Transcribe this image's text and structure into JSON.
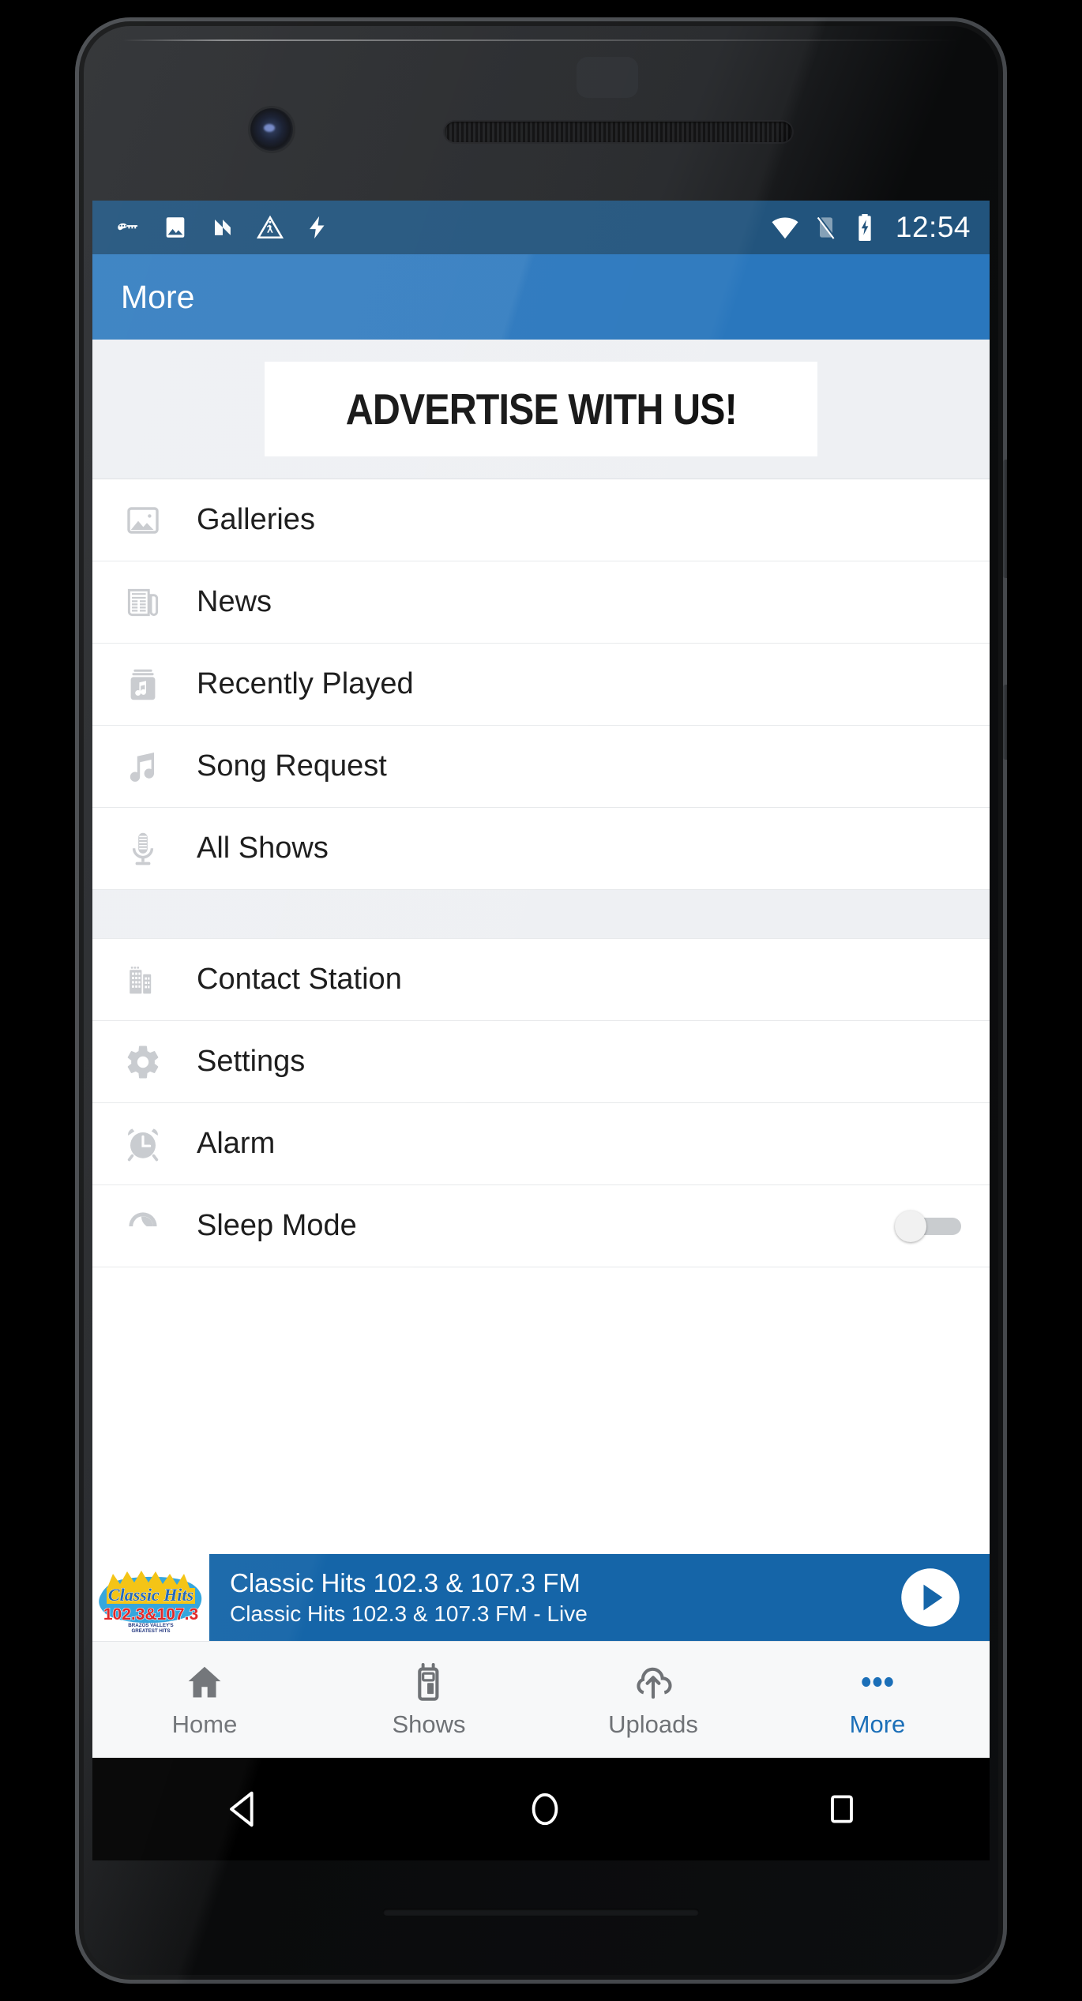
{
  "statusbar": {
    "time": "12:54",
    "left_icons": [
      "vpn-key-icon",
      "screenshot-image-icon",
      "android-nougat-icon",
      "work-in-progress-icon",
      "flash-icon"
    ],
    "right_icons": [
      "wifi-icon",
      "sim-off-icon",
      "battery-charging-icon"
    ]
  },
  "appbar": {
    "title": "More"
  },
  "ad": {
    "text": "ADVERTISE WITH US!"
  },
  "menu": {
    "group_one": [
      {
        "label": "Galleries",
        "icon": "image-icon"
      },
      {
        "label": "News",
        "icon": "newspaper-icon"
      },
      {
        "label": "Recently Played",
        "icon": "album-music-icon"
      },
      {
        "label": "Song Request",
        "icon": "music-note-icon"
      },
      {
        "label": "All Shows",
        "icon": "microphone-icon"
      }
    ],
    "group_two": [
      {
        "label": "Contact Station",
        "icon": "building-icon"
      },
      {
        "label": "Settings",
        "icon": "gear-icon"
      },
      {
        "label": "Alarm",
        "icon": "alarm-clock-icon"
      },
      {
        "label": "Sleep Mode",
        "icon": "sleep-moon-icon",
        "toggle": "off"
      }
    ]
  },
  "player": {
    "title": "Classic Hits 102.3 & 107.3 FM",
    "subtitle": "Classic Hits 102.3 & 107.3 FM - Live",
    "play_icon": "play-icon",
    "logo": {
      "script": "Classic Hits",
      "frequency": "102.3 & 107.3",
      "tagline_line1": "BRAZOS VALLEY'S",
      "tagline_line2": "GREATEST HITS"
    }
  },
  "bottomnav": {
    "items": [
      {
        "label": "Home",
        "icon": "home-icon",
        "active": false
      },
      {
        "label": "Shows",
        "icon": "radio-icon",
        "active": false
      },
      {
        "label": "Uploads",
        "icon": "cloud-upload-icon",
        "active": false
      },
      {
        "label": "More",
        "icon": "more-dots-icon",
        "active": true
      }
    ]
  },
  "androidnav": {
    "back": "back-triangle-icon",
    "home": "home-circle-icon",
    "recents": "recents-square-icon"
  },
  "colors": {
    "statusbar": "#22547d",
    "appbar": "#2a77bd",
    "player": "#1565a8",
    "accent": "#1b6fb8",
    "divider": "#e7e9eb",
    "spacer": "#eef0f3"
  }
}
